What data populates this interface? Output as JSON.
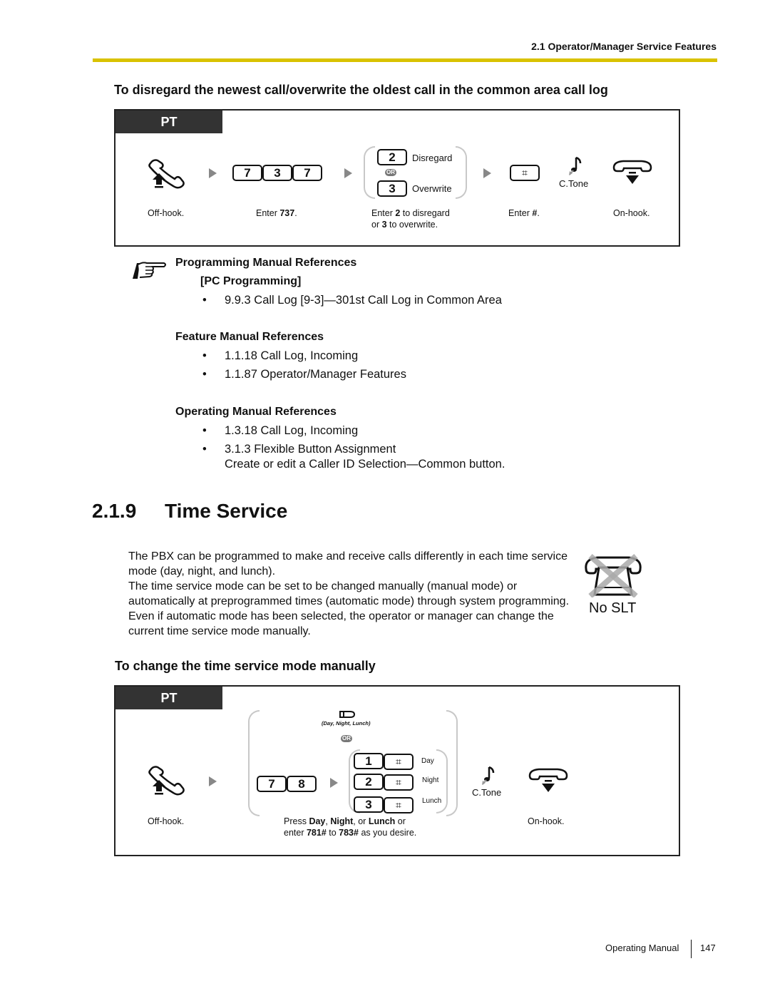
{
  "header": {
    "section_title": "2.1 Operator/Manager Service Features",
    "rule_color": "#d9c200"
  },
  "call_log_section": {
    "heading": "To disregard the newest call/overwrite the oldest call in the common area call log",
    "tab_label": "PT",
    "steps": {
      "offhook_caption": "Off-hook.",
      "keys_737": [
        "7",
        "3",
        "7"
      ],
      "enter_737_prefix": "Enter ",
      "enter_737_bold": "737",
      "enter_737_suffix": ".",
      "option_key_1": "2",
      "option_label_1": "Disregard",
      "or_label": "OR",
      "option_key_2": "3",
      "option_label_2": "Overwrite",
      "choice_caption_1_prefix": "Enter ",
      "choice_caption_1_bold": "2",
      "choice_caption_1_suffix": " to disregard",
      "choice_caption_2_prefix": "or ",
      "choice_caption_2_bold": "3",
      "choice_caption_2_suffix": " to overwrite.",
      "hash_key": "⌗",
      "enter_hash_prefix": "Enter ",
      "enter_hash_bold": "#",
      "enter_hash_suffix": ".",
      "ctone_label": "C.Tone",
      "onhook_caption": "On-hook."
    }
  },
  "references": {
    "programming": {
      "title": "Programming Manual References",
      "subtitle": "[PC Programming]",
      "items": [
        "9.9.3 Call Log [9-3]—301st Call Log in Common Area"
      ]
    },
    "feature": {
      "title": "Feature Manual References",
      "items": [
        "1.1.18 Call Log, Incoming",
        "1.1.87 Operator/Manager Features"
      ]
    },
    "operating": {
      "title": "Operating Manual References",
      "items": [
        "1.3.18 Call Log, Incoming",
        "3.1.3 Flexible Button Assignment"
      ],
      "item_2_note": "Create or edit a Caller ID Selection—Common button."
    }
  },
  "time_service": {
    "number": "2.1.9",
    "title": "Time Service",
    "paragraph_1": "The PBX can be programmed to make and receive calls differently in each time service mode (day, night, and lunch).",
    "paragraph_2": "The time service mode can be set to be changed manually (manual mode) or automatically at preprogrammed times (automatic mode) through system programming. Even if automatic mode has been selected, the operator or manager can change the current time service mode manually.",
    "no_slt_label": "No SLT",
    "subheading": "To change the time service mode manually",
    "tab_label": "PT",
    "steps": {
      "offhook_caption": "Off-hook.",
      "button_caption": "(Day, Night, Lunch)",
      "or_label": "OR",
      "keys_78": [
        "7",
        "8"
      ],
      "options": [
        {
          "key": "1",
          "label": "Day"
        },
        {
          "key": "2",
          "label": "Night"
        },
        {
          "key": "3",
          "label": "Lunch"
        }
      ],
      "hash_key": "⌗",
      "ctone_label": "C.Tone",
      "onhook_caption": "On-hook.",
      "press_caption_1": [
        "Press ",
        "Day",
        ", ",
        "Night",
        ", or ",
        "Lunch",
        " or"
      ],
      "press_caption_2": [
        "enter ",
        "781#",
        " to ",
        "783#",
        " as you desire."
      ]
    }
  },
  "footer": {
    "manual_name": "Operating Manual",
    "page_number": "147"
  }
}
